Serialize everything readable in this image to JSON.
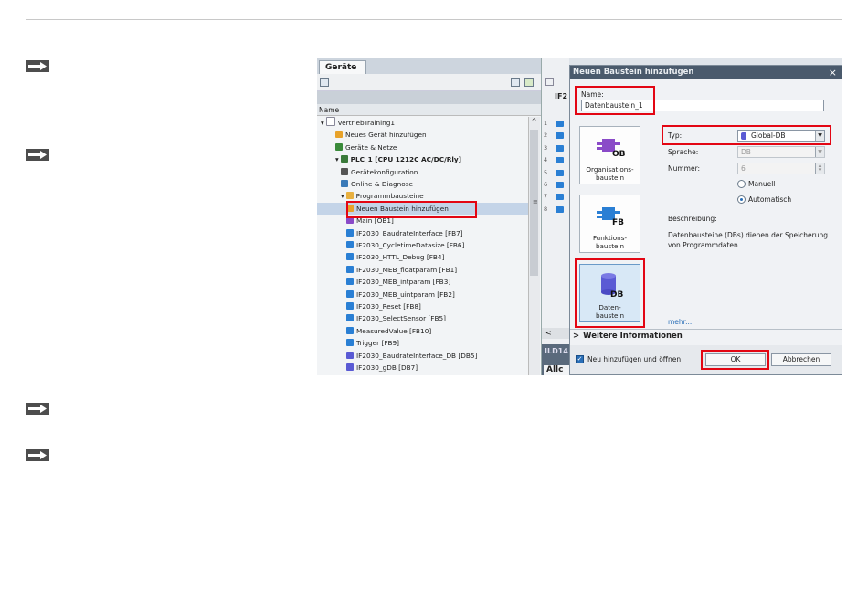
{
  "devices_panel": {
    "tab": "Geräte",
    "column_header": "Name",
    "tree": [
      {
        "label": "VertriebTraining1",
        "indent": 0,
        "icon": "doc-icon",
        "color": "#ffffff"
      },
      {
        "label": "Neues Gerät hinzufügen",
        "indent": 1,
        "icon": "add-device-icon",
        "color": "#e8a22a"
      },
      {
        "label": "Geräte & Netze",
        "indent": 1,
        "icon": "network-icon",
        "color": "#3a8a3a"
      },
      {
        "label": "PLC_1 [CPU 1212C AC/DC/Rly]",
        "indent": 1,
        "icon": "plc-icon",
        "color": "#3a7a3a",
        "bold": true
      },
      {
        "label": "Gerätekonfiguration",
        "indent": 2,
        "icon": "config-icon",
        "color": "#555555"
      },
      {
        "label": "Online & Diagnose",
        "indent": 2,
        "icon": "diagnostic-icon",
        "color": "#3a7ab8"
      },
      {
        "label": "Programmbausteine",
        "indent": 2,
        "icon": "folder-icon",
        "color": "#e8b040"
      },
      {
        "label": "Neuen Baustein hinzufügen",
        "indent": 3,
        "icon": "add-block-icon",
        "color": "#e8a22a"
      },
      {
        "label": "Main [OB1]",
        "indent": 3,
        "icon": "ob-icon",
        "color": "#8a4ac8"
      },
      {
        "label": "IF2030_BaudrateInterface [FB7]",
        "indent": 3,
        "icon": "fb-icon",
        "color": "#2a7fd4"
      },
      {
        "label": "IF2030_CycletimeDatasize [FB6]",
        "indent": 3,
        "icon": "fb-icon",
        "color": "#2a7fd4"
      },
      {
        "label": "IF2030_HTTL_Debug [FB4]",
        "indent": 3,
        "icon": "fb-icon",
        "color": "#2a7fd4"
      },
      {
        "label": "IF2030_MEB_floatparam [FB1]",
        "indent": 3,
        "icon": "fb-icon",
        "color": "#2a7fd4"
      },
      {
        "label": "IF2030_MEB_intparam [FB3]",
        "indent": 3,
        "icon": "fb-icon",
        "color": "#2a7fd4"
      },
      {
        "label": "IF2030_MEB_uintparam [FB2]",
        "indent": 3,
        "icon": "fb-icon",
        "color": "#2a7fd4"
      },
      {
        "label": "IF2030_Reset [FB8]",
        "indent": 3,
        "icon": "fb-icon",
        "color": "#2a7fd4"
      },
      {
        "label": "IF2030_SelectSensor [FB5]",
        "indent": 3,
        "icon": "fb-icon",
        "color": "#2a7fd4"
      },
      {
        "label": "MeasuredValue [FB10]",
        "indent": 3,
        "icon": "fb-icon",
        "color": "#2a7fd4"
      },
      {
        "label": "Trigger [FB9]",
        "indent": 3,
        "icon": "fb-icon",
        "color": "#2a7fd4"
      },
      {
        "label": "IF2030_BaudrateInterface_DB [DB5]",
        "indent": 3,
        "icon": "db-icon",
        "color": "#5a5ad4"
      },
      {
        "label": "IF2030_gDB [DB7]",
        "indent": 3,
        "icon": "db-icon",
        "color": "#5a5ad4"
      }
    ]
  },
  "middle_pane": {
    "header": "IF2",
    "rows": [
      "1",
      "2",
      "3",
      "4",
      "5",
      "6",
      "7",
      "8"
    ],
    "bottom_label": "ILD14",
    "bottom_tab": "Allc"
  },
  "dialog": {
    "title": "Neuen Baustein hinzufügen",
    "close": "×",
    "name_label": "Name:",
    "name_value": "Datenbaustein_1",
    "block_types": [
      {
        "badge": "OB",
        "label_line1": "Organisations-",
        "label_line2": "baustein",
        "color": "#8a4ac8"
      },
      {
        "badge": "FB",
        "label_line1": "Funktions-",
        "label_line2": "baustein",
        "color": "#2a7fd4"
      },
      {
        "badge": "DB",
        "label_line1": "Daten-",
        "label_line2": "baustein",
        "color": "#5a5ad4"
      }
    ],
    "type_label": "Typ:",
    "type_value": "Global-DB",
    "language_label": "Sprache:",
    "language_value": "DB",
    "number_label": "Nummer:",
    "number_value": "6",
    "radio_manual": "Manuell",
    "radio_auto": "Automatisch",
    "description_label": "Beschreibung:",
    "description_text_1": "Datenbausteine (DBs) dienen der Speicherung",
    "description_text_2": "von Programmdaten.",
    "more_link": "mehr...",
    "more_info": "Weitere Informationen",
    "open_checkbox": "Neu hinzufügen und öffnen",
    "ok_button": "OK",
    "cancel_button": "Abbrechen"
  },
  "colors": {
    "highlight": "#e30613",
    "dialog_title_bg": "#4a5a6c",
    "selection": "#c4d4e8"
  }
}
